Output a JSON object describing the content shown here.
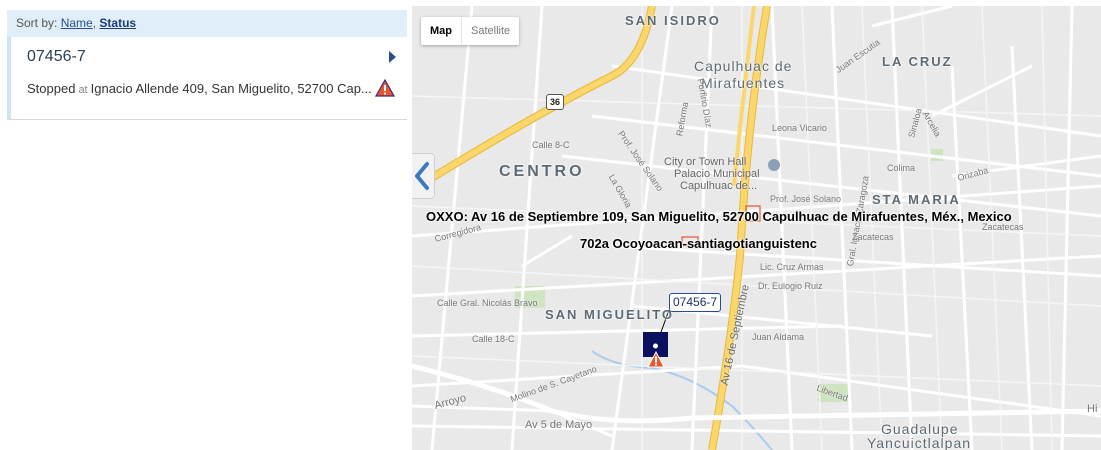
{
  "sidebar": {
    "sort_prefix": "Sort by:",
    "sort_name": "Name",
    "sort_separator": ",",
    "sort_status": "Status",
    "vehicle": {
      "id": "07456-7",
      "status": "Stopped",
      "at": "at",
      "address": "Ignacio Allende 409, San Miguelito, 52700 Cap..."
    }
  },
  "map": {
    "type_map": "Map",
    "type_satellite": "Satellite",
    "places": {
      "san_isidro": "SAN ISIDRO",
      "capulhuac1": "Capulhuac de",
      "capulhuac2": "Mirafuentes",
      "la_cruz": "LA CRUZ",
      "centro": "CENTRO",
      "sta_maria": "STA MARIA",
      "san_miguelito": "SAN MIGUELITO",
      "guadalupe1": "Guadalupe",
      "guadalupe2": "Yancuictlalpan"
    },
    "pois": {
      "city_hall": "City or Town Hall",
      "palacio1": "Palacio Municipal",
      "palacio2": "Capulhuac de..."
    },
    "streets": {
      "juan_escutia": "Juan Escutia",
      "reforma": "Reforma",
      "porfirio_diaz": "Porfirio Díaz",
      "calle8c": "Calle 8-C",
      "prof_jose_solano": "Prof. José Solano",
      "prof_jose_solano2": "Prof. José Solano",
      "la_gloria": "La Gloria",
      "leona_vicario": "Leona Vicario",
      "sinaloa": "Sinaloa",
      "arcelia": "Arcelia",
      "colima": "Colima",
      "orizaba": "Orizaba",
      "zaragoza": "Gral. Ignacio Zaragoza",
      "corregidora": "Corregidora",
      "zacatecas": "Zacatecas",
      "zacatecas2": "Zacatecas",
      "cruz_armas": "Lic. Cruz Armas",
      "eulogio": "Dr. Eulogio Ruiz",
      "nicolas_bravo": "Calle Gral. Nicolás Bravo",
      "calle18c": "Calle 18-C",
      "juan_aldama": "Juan Aldama",
      "av16": "Av 16 de Septiembre",
      "molino": "Molino de S. Cayetano",
      "arroyo": "Arroyo",
      "av5mayo": "Av 5 de Mayo",
      "libertad": "Libertad",
      "hi": "Hi",
      "route36": "36"
    },
    "overlay_line1": "OXXO: Av 16 de Septiembre 109, San Miguelito, 52700 Capulhuac de Mirafuentes, Méx., Mexico",
    "overlay_line2": "702a Ocoyoacan-santiagotianguistenc",
    "vehicle_tag": "07456-7",
    "colors": {
      "highway": "#fbd66a",
      "highway_edge": "#e6b93f",
      "marker": "#0c1060",
      "warning": "#e8562a"
    }
  }
}
